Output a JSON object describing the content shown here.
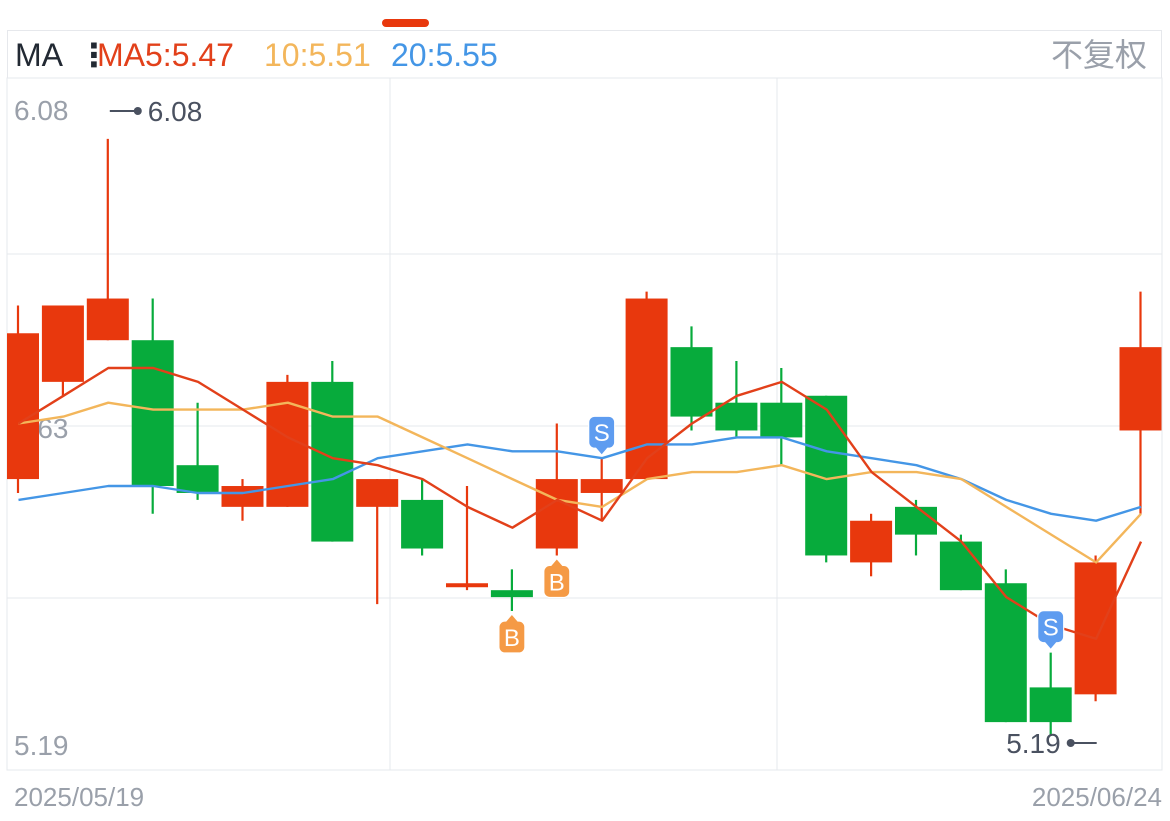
{
  "header": {
    "ma_label": "MA",
    "ma5_label": "MA5:5.47",
    "ma10_label": "10:5.51",
    "ma20_label": "20:5.55",
    "adjust_label": "不复权"
  },
  "colors": {
    "up": "#e8380d",
    "down": "#07ab3c",
    "ma5": "#e2401a",
    "ma10": "#f3b65b",
    "ma20": "#4496e6",
    "grid": "#e6e8ec",
    "axis_text": "#9aa0aa",
    "buy_marker": "#f59a45",
    "sell_marker": "#5e9cf0"
  },
  "x_axis": {
    "start_date": "2025/05/19",
    "end_date": "2025/06/24"
  },
  "chart_data": {
    "type": "candlestick",
    "ylim": [
      5.19,
      6.08
    ],
    "y_tick_labels": [
      "6.08",
      "5.63",
      "5.19"
    ],
    "high_label": "6.08",
    "low_label": "5.19",
    "candles": [
      {
        "open": 5.56,
        "close": 5.77,
        "high": 5.81,
        "low": 5.54
      },
      {
        "open": 5.7,
        "close": 5.81,
        "high": 5.76,
        "low": 5.68
      },
      {
        "open": 5.76,
        "close": 5.82,
        "high": 6.05,
        "low": 5.76
      },
      {
        "open": 5.76,
        "close": 5.55,
        "high": 5.82,
        "low": 5.51
      },
      {
        "open": 5.58,
        "close": 5.54,
        "high": 5.67,
        "low": 5.53
      },
      {
        "open": 5.52,
        "close": 5.55,
        "high": 5.56,
        "low": 5.5
      },
      {
        "open": 5.52,
        "close": 5.7,
        "high": 5.71,
        "low": 5.52
      },
      {
        "open": 5.7,
        "close": 5.47,
        "high": 5.73,
        "low": 5.47
      },
      {
        "open": 5.52,
        "close": 5.56,
        "high": 5.54,
        "low": 5.38
      },
      {
        "open": 5.53,
        "close": 5.46,
        "high": 5.56,
        "low": 5.45
      },
      {
        "open": 5.41,
        "close": 5.41,
        "high": 5.55,
        "low": 5.4
      },
      {
        "open": 5.4,
        "close": 5.39,
        "high": 5.43,
        "low": 5.37
      },
      {
        "open": 5.46,
        "close": 5.56,
        "high": 5.64,
        "low": 5.45
      },
      {
        "open": 5.54,
        "close": 5.56,
        "high": 5.59,
        "low": 5.5
      },
      {
        "open": 5.56,
        "close": 5.82,
        "high": 5.83,
        "low": 5.56
      },
      {
        "open": 5.75,
        "close": 5.65,
        "high": 5.78,
        "low": 5.63
      },
      {
        "open": 5.67,
        "close": 5.63,
        "high": 5.73,
        "low": 5.62
      },
      {
        "open": 5.67,
        "close": 5.62,
        "high": 5.72,
        "low": 5.58
      },
      {
        "open": 5.68,
        "close": 5.45,
        "high": 5.67,
        "low": 5.44
      },
      {
        "open": 5.44,
        "close": 5.5,
        "high": 5.51,
        "low": 5.42
      },
      {
        "open": 5.52,
        "close": 5.48,
        "high": 5.53,
        "low": 5.45
      },
      {
        "open": 5.47,
        "close": 5.4,
        "high": 5.48,
        "low": 5.4
      },
      {
        "open": 5.41,
        "close": 5.21,
        "high": 5.43,
        "low": 5.21
      },
      {
        "open": 5.26,
        "close": 5.21,
        "high": 5.31,
        "low": 5.19
      },
      {
        "open": 5.25,
        "close": 5.44,
        "high": 5.45,
        "low": 5.24
      },
      {
        "open": 5.63,
        "close": 5.75,
        "high": 5.83,
        "low": 5.51
      }
    ],
    "ma5": [
      5.64,
      5.68,
      5.72,
      5.72,
      5.7,
      5.66,
      5.62,
      5.59,
      5.58,
      5.56,
      5.52,
      5.49,
      5.53,
      5.5,
      5.59,
      5.64,
      5.68,
      5.7,
      5.66,
      5.57,
      5.52,
      5.47,
      5.39,
      5.35,
      5.33,
      5.47
    ],
    "ma10": [
      5.64,
      5.65,
      5.67,
      5.66,
      5.66,
      5.66,
      5.67,
      5.65,
      5.65,
      5.62,
      5.59,
      5.56,
      5.53,
      5.52,
      5.56,
      5.57,
      5.57,
      5.58,
      5.56,
      5.57,
      5.57,
      5.56,
      5.52,
      5.48,
      5.44,
      5.51
    ],
    "ma20": [
      5.53,
      5.54,
      5.55,
      5.55,
      5.54,
      5.54,
      5.55,
      5.56,
      5.59,
      5.6,
      5.61,
      5.6,
      5.6,
      5.59,
      5.61,
      5.61,
      5.62,
      5.62,
      5.6,
      5.59,
      5.58,
      5.56,
      5.53,
      5.51,
      5.5,
      5.52
    ],
    "signals": [
      {
        "index": 11,
        "type": "buy",
        "label": "B"
      },
      {
        "index": 12,
        "type": "buy",
        "label": "B"
      },
      {
        "index": 13,
        "type": "sell",
        "label": "S"
      },
      {
        "index": 23,
        "type": "sell",
        "label": "S"
      }
    ]
  }
}
